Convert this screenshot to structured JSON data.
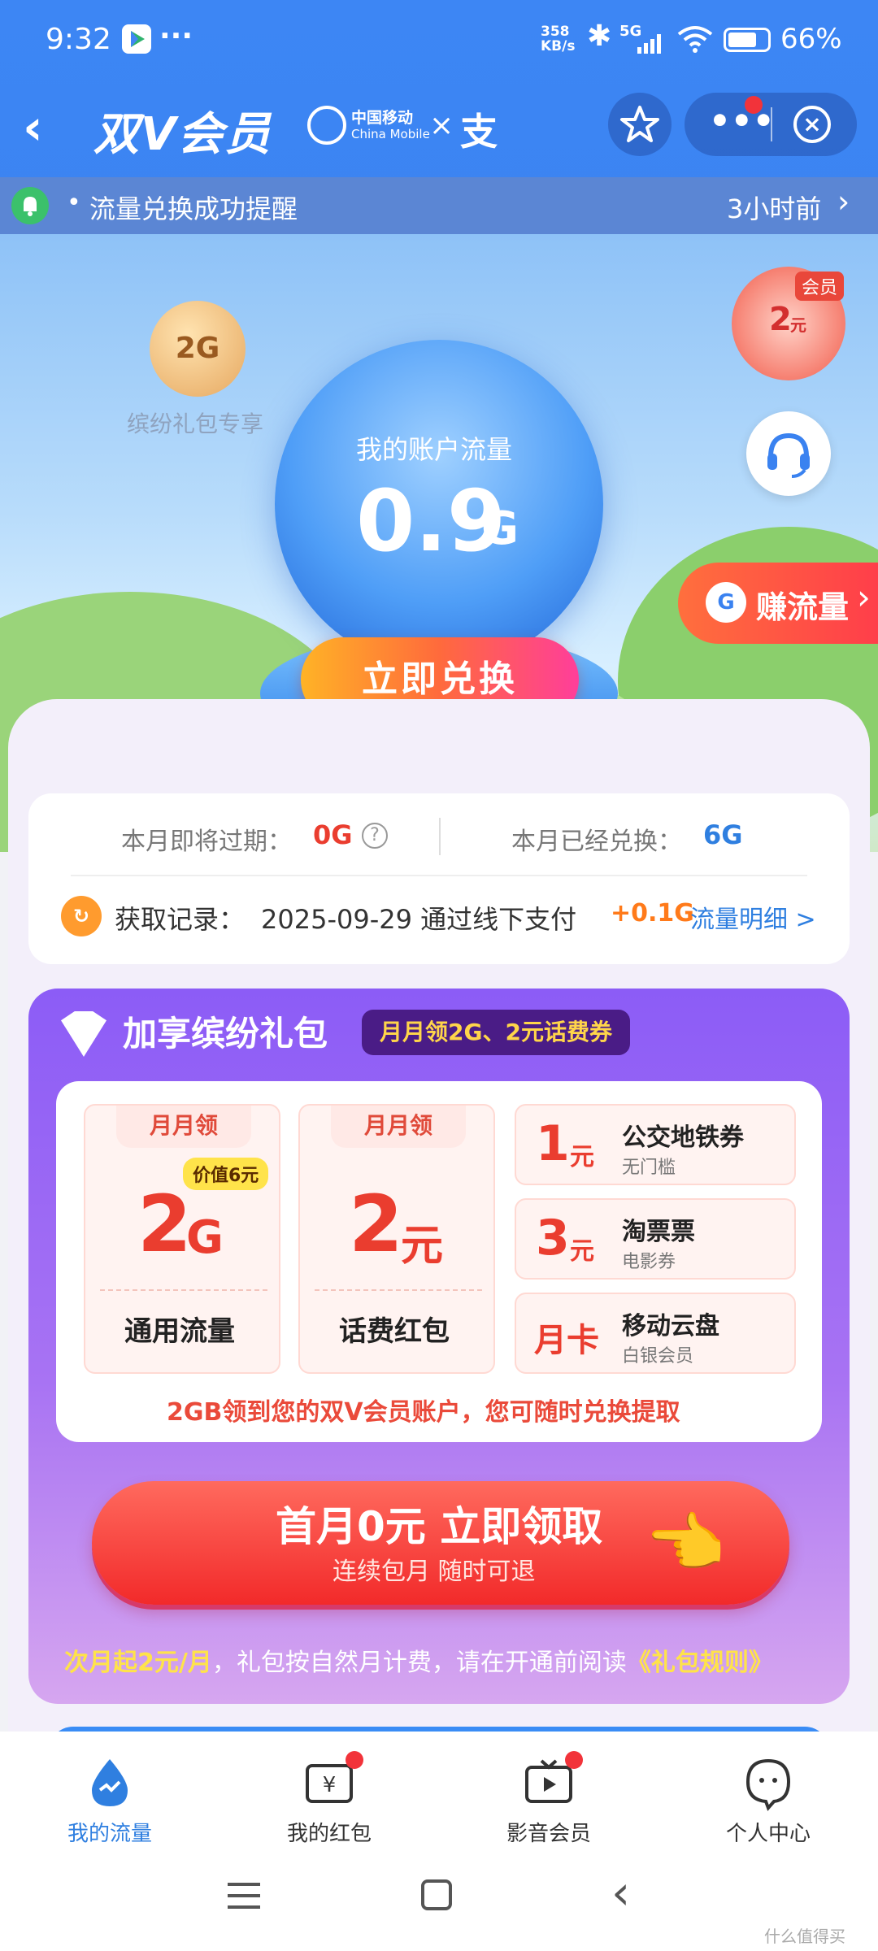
{
  "status": {
    "time": "9:32",
    "net_speed": "358\nKB/s",
    "net_type": "5G",
    "battery": "66%"
  },
  "header": {
    "title": "双V会员",
    "partner_cn": "中国移动",
    "partner_en": "China Mobile",
    "times": "×",
    "partner2": "支"
  },
  "notice": {
    "text": "流量兑换成功提醒",
    "time": "3小时前"
  },
  "hero": {
    "badge_value": "2G",
    "badge_caption": "缤纷礼包专享",
    "globe_label": "我的账户流量",
    "globe_value": "0.9",
    "globe_unit": "G",
    "exchange_button": "立即兑换",
    "member_badge": "会员",
    "member_value": "2",
    "member_unit": "元",
    "earn_label": "赚流量",
    "earn_chip": "G"
  },
  "stats": {
    "expiring_label": "本月即将过期：",
    "expiring_value": "0G",
    "help": "?",
    "exchanged_label": "本月已经兑换：",
    "exchanged_value": "6G",
    "record_label": "获取记录：",
    "record_text": "2025-09-29 通过线下支付",
    "record_amount": "+0.1G",
    "detail_link": "流量明细 >"
  },
  "gift": {
    "title": "加享缤纷礼包",
    "subtitle": "月月领2G、2元话费券",
    "items": [
      {
        "tag": "月月领",
        "badge": "价值6元",
        "value": "2",
        "unit": "G",
        "name": "通用流量"
      },
      {
        "tag": "月月领",
        "value": "2",
        "unit": "元",
        "name": "话费红包"
      }
    ],
    "coupons": [
      {
        "value": "1",
        "unit": "元",
        "title": "公交地铁券",
        "sub": "无门槛"
      },
      {
        "value": "3",
        "unit": "元",
        "title": "淘票票",
        "sub": "电影券"
      },
      {
        "value": "月卡",
        "unit": "",
        "title": "移动云盘",
        "sub": "白银会员"
      }
    ],
    "note": "2GB领到您的双V会员账户，您可随时兑换提取",
    "cta_title": "首月0元 立即领取",
    "cta_sub": "连续包月 随时可退",
    "rule_highlight": "次月起2元/月",
    "rule_text": "，礼包按自然月计费，请在开通前阅读",
    "rule_link": "《礼包规则》"
  },
  "nav": [
    {
      "label": "我的流量",
      "active": true
    },
    {
      "label": "我的红包"
    },
    {
      "label": "影音会员"
    },
    {
      "label": "个人中心"
    }
  ],
  "watermark": "什么值得买",
  "colors": {
    "brand_blue": "#3b84f2",
    "accent_red": "#ea3d2f",
    "link_blue": "#2f7fe0",
    "purple": "#8c5cf6"
  }
}
